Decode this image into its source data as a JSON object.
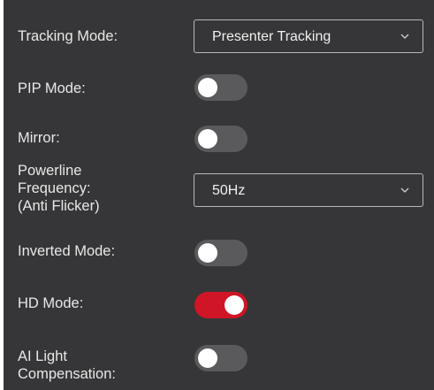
{
  "settings": {
    "tracking_mode": {
      "label": "Tracking Mode:",
      "value": "Presenter Tracking",
      "icon": "chevron-down-icon"
    },
    "pip_mode": {
      "label": "PIP Mode:",
      "on": false
    },
    "mirror": {
      "label": "Mirror:",
      "on": false
    },
    "powerline_frequency": {
      "label": "Powerline\nFrequency:\n(Anti Flicker)",
      "value": "50Hz",
      "icon": "chevron-down-icon"
    },
    "inverted_mode": {
      "label": "Inverted Mode:",
      "on": false
    },
    "hd_mode": {
      "label": "HD Mode:",
      "on": true
    },
    "ai_light_compensation": {
      "label": "AI Light\nCompensation:",
      "on": false
    }
  },
  "colors": {
    "panel_background": "#363638",
    "toggle_off": "#5a5a5c",
    "toggle_on": "#cf1526",
    "text": "#e8e8e8"
  }
}
